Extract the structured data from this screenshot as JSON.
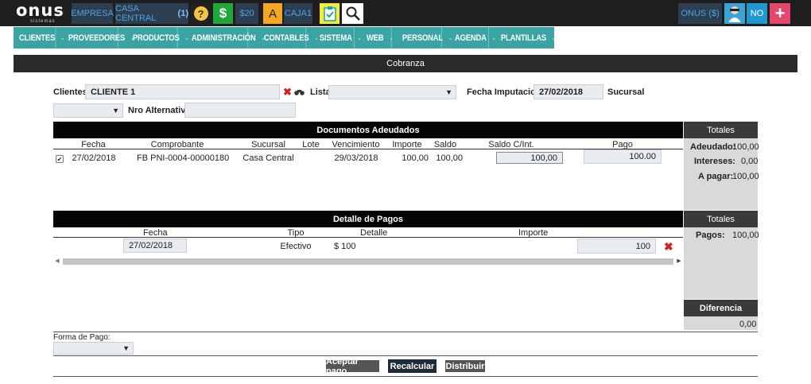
{
  "topbar": {
    "logo": "onus",
    "logo_sub": "sistemas",
    "empresa": "EMPRESA",
    "casa_central": "CASA CENTRAL",
    "casa_central_count": "(1)",
    "help_glyph": "?",
    "dollar_glyph": "$",
    "balance": "$20",
    "letter": "A",
    "caja": "CAJA1",
    "user": "ONUS ($)",
    "no": "NO",
    "plus": "+"
  },
  "nav": {
    "items": [
      {
        "label": "CLIENTES"
      },
      {
        "label": "PROVEEDORES"
      },
      {
        "label": "PRODUCTOS"
      },
      {
        "label": "ADMINISTRACIÓN"
      },
      {
        "label": "CONTABLES"
      },
      {
        "label": "SISTEMA"
      },
      {
        "label": "WEB"
      },
      {
        "label": "PERSONAL"
      },
      {
        "label": "AGENDA"
      },
      {
        "label": "PLANTILLAS"
      }
    ]
  },
  "page_title": "Cobranza",
  "form": {
    "clientes_label": "Clientes",
    "clientes_value": "CLIENTE 1",
    "lista_label": "Lista",
    "lista_value": "",
    "fecha_label": "Fecha Imputacion:",
    "fecha_value": "27/02/2018",
    "sucursal_label": "Sucursal",
    "nro_label": "Nro Alternativo:",
    "nro_value": ""
  },
  "documentos": {
    "title": "Documentos Adeudados",
    "headers": {
      "fecha": "Fecha",
      "comprobante": "Comprobante",
      "sucursal": "Sucursal",
      "lote": "Lote",
      "vencimiento": "Vencimiento",
      "importe": "Importe",
      "saldo": "Saldo",
      "saldo_int": "Saldo C/Int.",
      "pago": "Pago"
    },
    "rows": [
      {
        "checked": true,
        "fecha": "27/02/2018",
        "comprobante": "FB PNI-0004-00000180",
        "sucursal": "Casa Central",
        "lote": "",
        "vencimiento": "29/03/2018",
        "importe": "100,00",
        "saldo": "100,00",
        "saldo_int": "100,00",
        "pago": "100.00"
      }
    ]
  },
  "totales1": {
    "title": "Totales",
    "adeudado_label": "Adeudado:",
    "adeudado_value": "100,00",
    "intereses_label": "Intereses:",
    "intereses_value": "0,00",
    "apagar_label": "A pagar:",
    "apagar_value": "100,00"
  },
  "pagos": {
    "title": "Detalle de Pagos",
    "headers": {
      "fecha": "Fecha",
      "tipo": "Tipo",
      "detalle": "Detalle",
      "importe": "Importe"
    },
    "rows": [
      {
        "fecha": "27/02/2018",
        "tipo": "Efectivo",
        "detalle": "$ 100",
        "importe": "100"
      }
    ]
  },
  "totales2": {
    "title": "Totales",
    "pagos_label": "Pagos:",
    "pagos_value": "100,00"
  },
  "diferencia": {
    "title": "Diferencia",
    "value": "0,00"
  },
  "forma_pago": {
    "label": "Forma de Pago:",
    "value": ""
  },
  "buttons": {
    "aceptar": "Aceptar pago",
    "recalcular": "Recalcular",
    "distribuir": "Distribuir"
  }
}
